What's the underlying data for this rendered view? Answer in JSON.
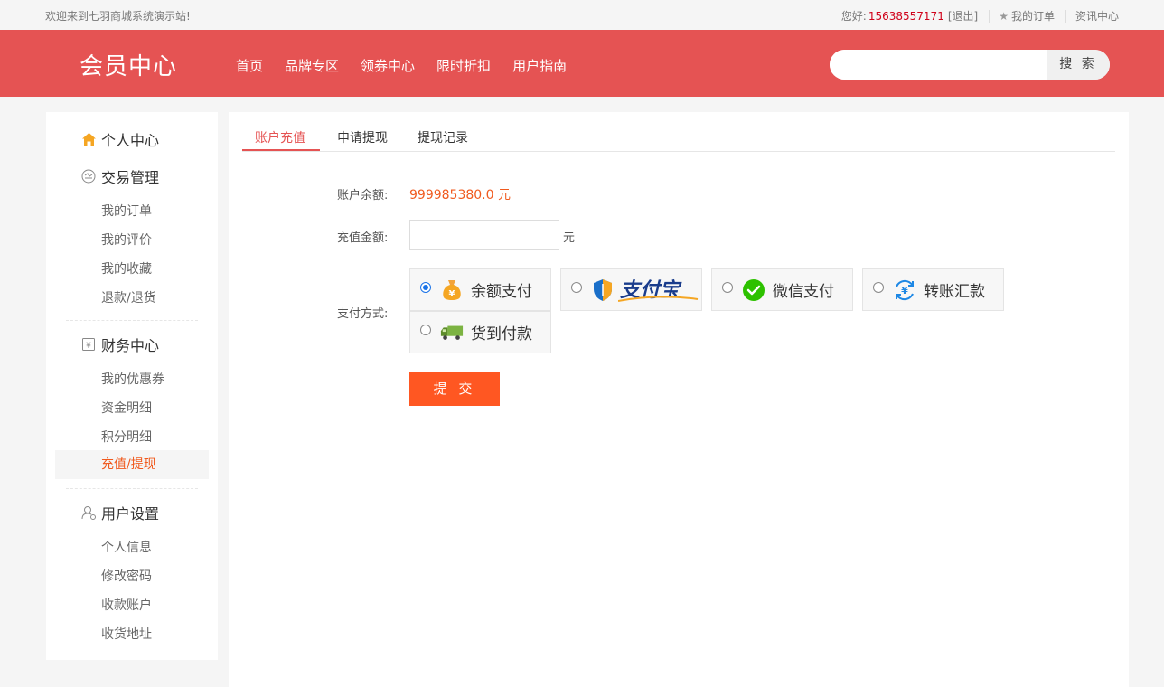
{
  "topbar": {
    "welcome": "欢迎来到七羽商城系统演示站!",
    "hello": "您好:",
    "phone": "15638557171",
    "logout": "[退出]",
    "my_orders": "我的订单",
    "news": "资讯中心"
  },
  "header": {
    "title": "会员中心",
    "nav": [
      "首页",
      "品牌专区",
      "领券中心",
      "限时折扣",
      "用户指南"
    ],
    "search_placeholder": "",
    "search_button": "搜 索"
  },
  "sidebar": {
    "personal_center": "个人中心",
    "trade": {
      "title": "交易管理",
      "items": [
        "我的订单",
        "我的评价",
        "我的收藏",
        "退款/退货"
      ]
    },
    "finance": {
      "title": "财务中心",
      "items": [
        "我的优惠券",
        "资金明细",
        "积分明细",
        "充值/提现"
      ],
      "active_index": 3
    },
    "settings": {
      "title": "用户设置",
      "items": [
        "个人信息",
        "修改密码",
        "收款账户",
        "收货地址"
      ]
    }
  },
  "tabs": [
    "账户充值",
    "申请提现",
    "提现记录"
  ],
  "form": {
    "balance_label": "账户余额:",
    "balance_value": "999985380.0 元",
    "amount_label": "充值金额:",
    "amount_value": "",
    "amount_unit": "元",
    "method_label": "支付方式:",
    "methods": [
      {
        "label": "余额支付",
        "icon": "money-bag-icon",
        "checked": true
      },
      {
        "label": "支付宝",
        "icon": "alipay-logo",
        "checked": false
      },
      {
        "label": "微信支付",
        "icon": "wechat-icon",
        "checked": false
      },
      {
        "label": "转账汇款",
        "icon": "transfer-icon",
        "checked": false
      },
      {
        "label": "货到付款",
        "icon": "truck-icon",
        "checked": false
      }
    ],
    "submit": "提 交"
  },
  "colors": {
    "brand": "#e55353",
    "accent": "#f05a1e",
    "submit": "#ff5722"
  }
}
